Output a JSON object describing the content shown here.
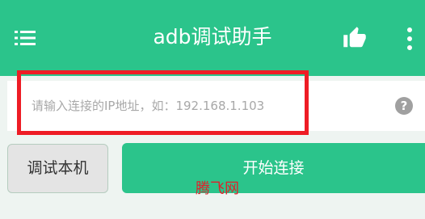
{
  "appbar": {
    "title": "adb调试助手",
    "menu_icon": "hamburger-menu-icon",
    "like_icon": "thumbs-up-icon",
    "more_icon": "more-vertical-icon",
    "color": "#2bc48b"
  },
  "connection": {
    "ip_placeholder": "请输入连接的IP地址，如：192.168.1.103",
    "ip_value": "",
    "help_icon": "question-mark-circle-icon",
    "help_glyph": "?"
  },
  "actions": {
    "debug_local_label": "调试本机",
    "start_connect_label": "开始连接"
  },
  "highlight": {
    "color": "#ee1c25"
  },
  "watermark": {
    "text": "腾飞网"
  }
}
